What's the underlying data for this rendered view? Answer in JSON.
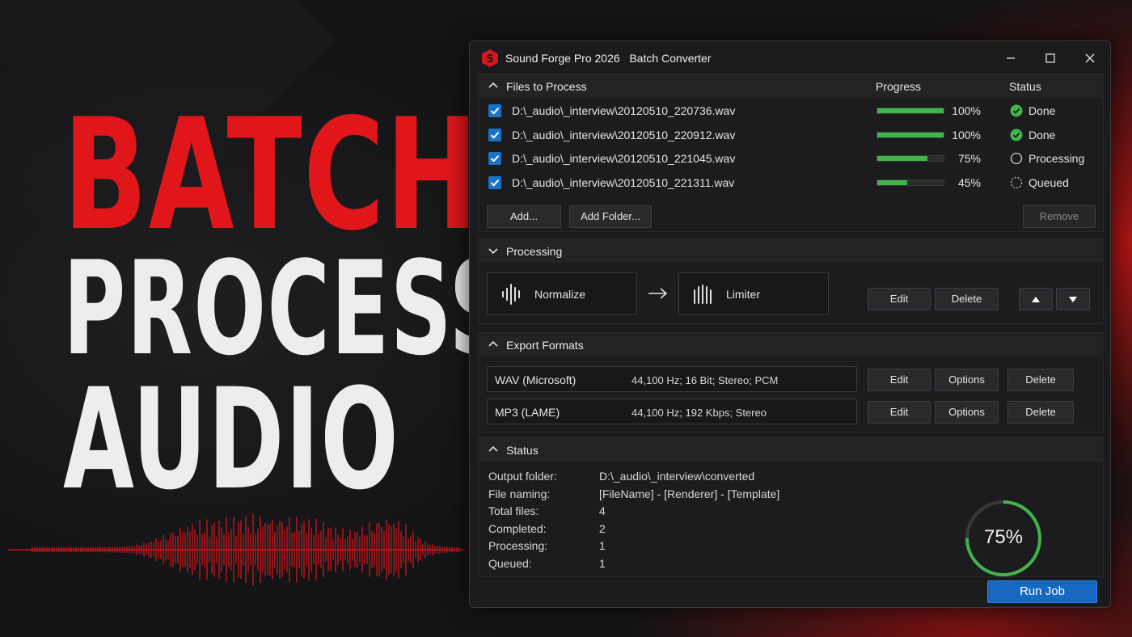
{
  "poster": {
    "line1": "BATCH",
    "line2": "PROCESS",
    "line3": "AUDIO"
  },
  "window": {
    "title": "Sound Forge Pro 2026   Batch Converter",
    "controls": {
      "minimize_icon": "minimize-icon",
      "maximize_icon": "maximize-icon",
      "close_icon": "close-icon"
    }
  },
  "files": {
    "header": "Files to Process",
    "col_progress": "Progress",
    "col_status": "Status",
    "rows": [
      {
        "checked": true,
        "name": "D:\\_audio\\_interview\\20120510_220736.wav",
        "progress": 1.0,
        "progress_label": "100%",
        "status": "Done",
        "status_icon": "check-circle-icon"
      },
      {
        "checked": true,
        "name": "D:\\_audio\\_interview\\20120510_220912.wav",
        "progress": 1.0,
        "progress_label": "100%",
        "status": "Done",
        "status_icon": "check-circle-icon"
      },
      {
        "checked": true,
        "name": "D:\\_audio\\_interview\\20120510_221045.wav",
        "progress": 0.75,
        "progress_label": "75%",
        "status": "Processing",
        "status_icon": "processing-circle-icon"
      },
      {
        "checked": true,
        "name": "D:\\_audio\\_interview\\20120510_221311.wav",
        "progress": 0.45,
        "progress_label": "45%",
        "status": "Queued",
        "status_icon": "queued-circle-icon"
      }
    ],
    "add_label": "Add...",
    "add_folder_label": "Add Folder...",
    "remove_label": "Remove"
  },
  "processing": {
    "header": "Processing",
    "chain": [
      "Normalize",
      "Limiter"
    ],
    "edit_label": "Edit",
    "delete_label": "Delete"
  },
  "export": {
    "header": "Export Formats",
    "formats": [
      {
        "name": "WAV (Microsoft)",
        "desc": "44,100 Hz; 16 Bit; Stereo; PCM"
      },
      {
        "name": "MP3 (LAME)",
        "desc": "44,100 Hz; 192 Kbps; Stereo"
      }
    ],
    "edit_label": "Edit",
    "options_label": "Options",
    "delete_label": "Delete"
  },
  "status": {
    "header": "Status",
    "fields": [
      {
        "label": "Output folder:",
        "value": "D:\\_audio\\_interview\\converted"
      },
      {
        "label": "File naming:",
        "value": "[FileName] - [Renderer] - [Template]"
      },
      {
        "label": "Total files:",
        "value": "4"
      },
      {
        "label": "Completed:",
        "value": "2"
      },
      {
        "label": "Processing:",
        "value": "1"
      },
      {
        "label": "Queued:",
        "value": "1"
      }
    ],
    "overall_progress": 0.75,
    "overall_label": "75%"
  },
  "run_label": "Run Job",
  "colors": {
    "accent_red": "#e0161a",
    "progress_green": "#3fb54a",
    "checkbox_blue": "#1a73c9",
    "run_button_blue": "#1668c0"
  }
}
